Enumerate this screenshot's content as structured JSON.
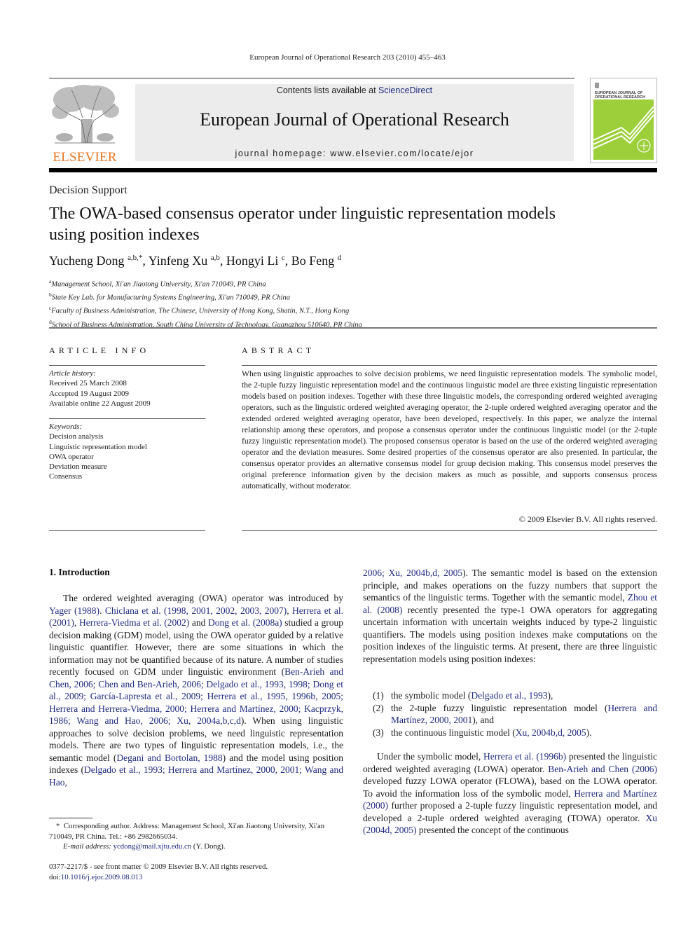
{
  "header": {
    "running_head": "European Journal of Operational Research 203 (2010) 455–463",
    "contents_prefix": "Contents lists available at ",
    "contents_link": "ScienceDirect",
    "journal_title": "European Journal of Operational Research",
    "homepage_label": "journal homepage: ",
    "homepage_url": "www.elsevier.com/locate/ejor",
    "publisher_logo_text": "ELSEVIER",
    "cover_title_line1": "EUROPEAN JOURNAL OF",
    "cover_title_line2": "OPERATIONAL RESEARCH",
    "colors": {
      "elsevier_orange": "#e87722",
      "cover_green": "#9ccf3a",
      "link_blue": "#1f2a80",
      "banner_gray": "#ececec"
    }
  },
  "article": {
    "section": "Decision Support",
    "title_line1": "The OWA-based consensus operator under linguistic representation models",
    "title_line2": "using position indexes",
    "authors": [
      {
        "name": "Yucheng Dong",
        "sup": "a,b,*",
        "sep": ", "
      },
      {
        "name": "Yinfeng Xu",
        "sup": "a,b",
        "sep": ", "
      },
      {
        "name": "Hongyi Li",
        "sup": "c",
        "sep": ", "
      },
      {
        "name": "Bo Feng",
        "sup": "d",
        "sep": ""
      }
    ],
    "affiliations": [
      {
        "sup": "a",
        "text": "Management School, Xi'an Jiaotong University, Xi'an 710049, PR China"
      },
      {
        "sup": "b",
        "text": "State Key Lab. for Manufacturing Systems Engineering, Xi'an 710049, PR China"
      },
      {
        "sup": "c",
        "text": "Faculty of Business Administration, The Chinese, University of Hong Kong, Shatin, N.T., Hong Kong"
      },
      {
        "sup": "d",
        "text": "School of Business Administration, South China University of Technology, Guangzhou 510640, PR China"
      }
    ]
  },
  "article_info": {
    "heading": "ARTICLE INFO",
    "history_label": "Article history:",
    "history": [
      "Received 25 March 2008",
      "Accepted 19 August 2009",
      "Available online 22 August 2009"
    ],
    "keywords_label": "Keywords:",
    "keywords": [
      "Decision analysis",
      "Linguistic representation model",
      "OWA operator",
      "Deviation measure",
      "Consensus"
    ]
  },
  "abstract": {
    "heading": "ABSTRACT",
    "text": "When using linguistic approaches to solve decision problems, we need linguistic representation models. The symbolic model, the 2-tuple fuzzy linguistic representation model and the continuous linguistic model are three existing linguistic representation models based on position indexes. Together with these three linguistic models, the corresponding ordered weighted averaging operators, such as the linguistic ordered weighted averaging operator, the 2-tuple ordered weighted averaging operator and the extended ordered weighted averaging operator, have been developed, respectively. In this paper, we analyze the internal relationship among these operators, and propose a consensus operator under the continuous linguistic model (or the 2-tuple fuzzy linguistic representation model). The proposed consensus operator is based on the use of the ordered weighted averaging operator and the deviation measures. Some desired properties of the consensus operator are also presented. In particular, the consensus operator provides an alternative consensus model for group decision making. This consensus model preserves the original preference information given by the decision makers as much as possible, and supports consensus process automatically, without moderator.",
    "copyright": "© 2009 Elsevier B.V. All rights reserved."
  },
  "body": {
    "intro_heading": "1. Introduction",
    "left_paragraph": [
      {
        "t": "The ordered weighted averaging (OWA) operator was introduced by "
      },
      {
        "l": "Yager (1988)"
      },
      {
        "t": ". "
      },
      {
        "l": "Chiclana et al. (1998, 2001, 2002, 2003, 2007)"
      },
      {
        "t": ", "
      },
      {
        "l": "Herrera et al. (2001)"
      },
      {
        "t": ", "
      },
      {
        "l": "Herrera-Viedma et al. (2002)"
      },
      {
        "t": " and "
      },
      {
        "l": "Dong et al. (2008a)"
      },
      {
        "t": " studied a group decision making (GDM) model, using the OWA operator guided by a relative linguistic quantifier. However, there are some situations in which the information may not be quantified because of its nature. A number of studies recently focused on GDM under linguistic environment ("
      },
      {
        "l": "Ben-Arieh and Chen, 2006; Chen and Ben-Arieh, 2006; Delgado et al., 1993, 1998; Dong et al., 2009; García-Lapresta et al., 2009; Herrera et al., 1995, 1996b, 2005; Herrera and Herrera-Viedma, 2000; Herrera and Martínez, 2000; Kacprzyk, 1986; Wang and Hao, 2006; Xu, 2004a,b,c,d"
      },
      {
        "t": "). When using linguistic approaches to solve decision problems, we need linguistic representation models. There are two types of linguistic representation models, i.e., the semantic model ("
      },
      {
        "l": "Degani and Bortolan, 1988"
      },
      {
        "t": ") and the model using position indexes ("
      },
      {
        "l": "Delgado et al., 1993; Herrera and Martínez, 2000, 2001; Wang and Hao,"
      }
    ],
    "right_paragraph1": [
      {
        "l": "2006; Xu, 2004b,d, 2005"
      },
      {
        "t": "). The semantic model is based on the extension principle, and makes operations on the fuzzy numbers that support the semantics of the linguistic terms. Together with the semantic model, "
      },
      {
        "l": "Zhou et al. (2008)"
      },
      {
        "t": " recently presented the type-1 OWA operators for aggregating uncertain information with uncertain weights induced by type-2 linguistic quantifiers. The models using position indexes make computations on the position indexes of the linguistic terms. At present, there are three linguistic representation models using position indexes:"
      }
    ],
    "list": [
      {
        "num": "(1)",
        "parts": [
          {
            "t": "the symbolic model ("
          },
          {
            "l": "Delgado et al., 1993"
          },
          {
            "t": "),"
          }
        ]
      },
      {
        "num": "(2)",
        "parts": [
          {
            "t": "the 2-tuple fuzzy linguistic representation model ("
          },
          {
            "l": "Herrera and Martínez, 2000, 2001"
          },
          {
            "t": "), and"
          }
        ]
      },
      {
        "num": "(3)",
        "parts": [
          {
            "t": "the continuous linguistic model ("
          },
          {
            "l": "Xu, 2004b,d, 2005"
          },
          {
            "t": ")."
          }
        ]
      }
    ],
    "right_paragraph2": [
      {
        "t": "Under the symbolic model, "
      },
      {
        "l": "Herrera et al. (1996b)"
      },
      {
        "t": " presented the linguistic ordered weighted averaging (LOWA) operator. "
      },
      {
        "l": "Ben-Arieh and Chen (2006)"
      },
      {
        "t": " developed fuzzy LOWA operator (FLOWA), based on the LOWA operator. To avoid the information loss of the symbolic model, "
      },
      {
        "l": "Herrera and Martínez (2000)"
      },
      {
        "t": " further proposed a 2-tuple fuzzy linguistic representation model, and developed a 2-tuple ordered weighted averaging (TOWA) operator. "
      },
      {
        "l": "Xu (2004d, 2005)"
      },
      {
        "t": " presented the concept of the continuous"
      }
    ]
  },
  "footnote": {
    "marker": "*",
    "text": "Corresponding author. Address: Management School, Xi'an Jiaotong University, Xi'an 710049, PR China. Tel.: +86 2982665034.",
    "email_label": "E-mail address: ",
    "email": "ycdong@mail.xjtu.edu.cn",
    "email_suffix": " (Y. Dong)."
  },
  "imprint": {
    "issn_line": "0377-2217/$ - see front matter © 2009 Elsevier B.V. All rights reserved.",
    "doi_label": "doi:",
    "doi": "10.1016/j.ejor.2009.08.013"
  }
}
